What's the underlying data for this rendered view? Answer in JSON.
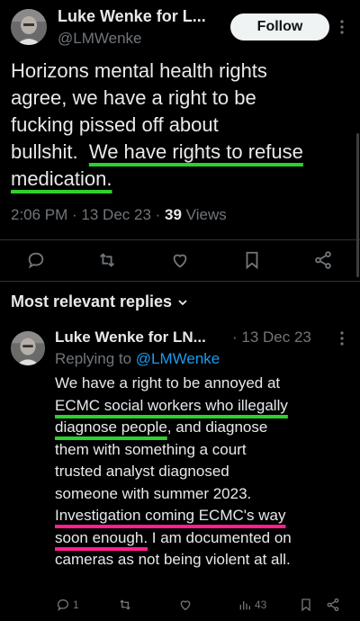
{
  "post": {
    "author_name": "Luke Wenke for L...",
    "author_handle": "@LMWenke",
    "follow_label": "Follow",
    "text_lines": [
      "Horizons mental health rights",
      "agree, we have a right to be",
      "fucking pissed off about",
      "bullshit.",
      "We have rights to refuse",
      "medication."
    ],
    "time_date": "2:06 PM · 13 Dec 23 · ",
    "views_count": "39",
    "views_label": " Views"
  },
  "replies_section": {
    "title": "Most relevant replies"
  },
  "reply": {
    "author_name": "Luke Wenke for LN...",
    "date": "· 13 Dec 23",
    "replying_prefix": "Replying to ",
    "replying_handle": "@LMWenke",
    "lines": [
      "We have a right to be annoyed at",
      "ECMC social workers who illegally",
      "diagnose people",
      ", and diagnose",
      "them with something a court",
      "trusted analyst diagnosed",
      "someone with summer 2023.",
      "Investigation coming ECMC's way",
      "soon enough.",
      " I am documented on",
      "cameras as not being violent at all."
    ],
    "reply_count": "1",
    "views_count": "43"
  },
  "colors": {
    "background": "#000000",
    "text": "#e7e9ea",
    "muted": "#71767b",
    "link": "#1d9bf0",
    "highlight_green": "#2dd12d",
    "highlight_pink": "#ff1f8f"
  },
  "icons": {
    "more": "more-vertical-icon",
    "reply": "reply-icon",
    "retweet": "retweet-icon",
    "like": "heart-icon",
    "bookmark": "bookmark-icon",
    "share": "share-icon",
    "views": "views-chart-icon",
    "chevron": "chevron-down-icon"
  }
}
